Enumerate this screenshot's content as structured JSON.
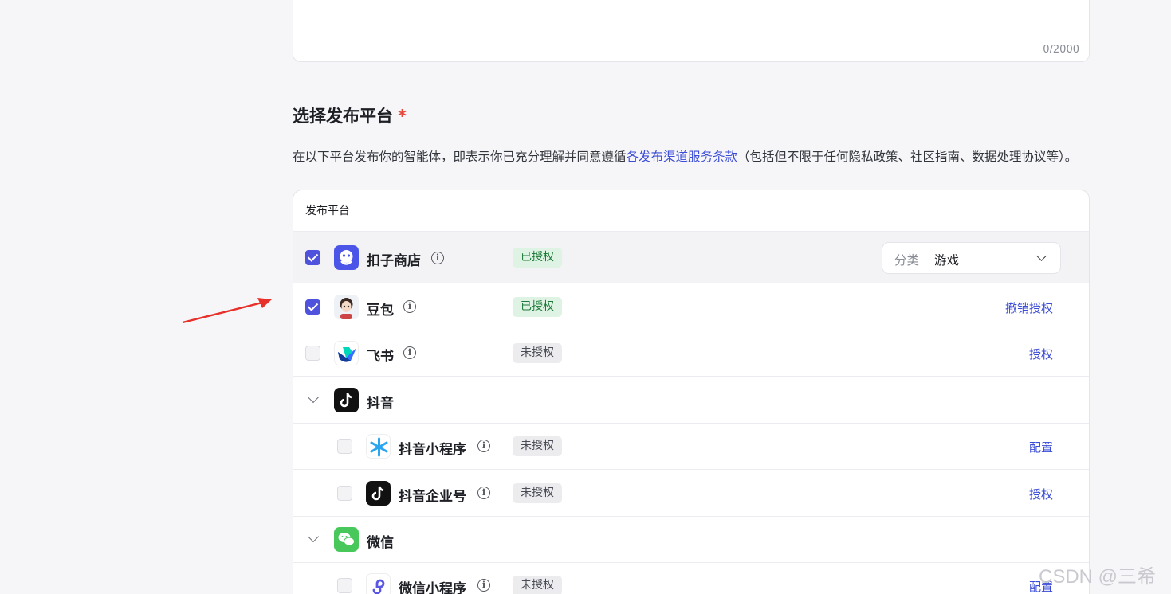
{
  "description_box": {
    "char_count": "0/2000"
  },
  "section": {
    "title": "选择发布平台",
    "required_mark": "*",
    "desc_before": "在以下平台发布你的智能体，即表示你已充分理解并同意遵循",
    "desc_link": "各发布渠道服务条款",
    "desc_after": "（包括但不限于任何隐私政策、社区指南、数据处理协议等）。"
  },
  "table": {
    "header": "发布平台",
    "rows": [
      {
        "name": "扣子商店",
        "checked": true,
        "badge": "已授权",
        "status": "authorized",
        "category_label": "分类",
        "category_value": "游戏",
        "icon": "coze-store-icon"
      },
      {
        "name": "豆包",
        "checked": true,
        "badge": "已授权",
        "status": "authorized",
        "action": "撤销授权",
        "icon": "doubao-icon"
      },
      {
        "name": "飞书",
        "checked": false,
        "badge": "未授权",
        "status": "unauthorized",
        "action": "授权",
        "icon": "feishu-icon"
      },
      {
        "name": "抖音",
        "group": true,
        "expanded": true,
        "icon": "douyin-icon"
      },
      {
        "name": "抖音小程序",
        "checked": false,
        "badge": "未授权",
        "status": "unauthorized",
        "action": "配置",
        "icon": "douyin-miniapp-icon"
      },
      {
        "name": "抖音企业号",
        "checked": false,
        "badge": "未授权",
        "status": "unauthorized",
        "action": "授权",
        "icon": "douyin-enterprise-icon"
      },
      {
        "name": "微信",
        "group": true,
        "expanded": true,
        "icon": "wechat-icon"
      },
      {
        "name": "微信小程序",
        "checked": false,
        "badge": "未授权",
        "status": "unauthorized",
        "action": "配置",
        "icon": "wechat-miniapp-icon"
      }
    ]
  },
  "watermark": "CSDN @三希",
  "colors": {
    "accent": "#4e52dc",
    "link": "#3b4cd6",
    "authorized_bg": "#dff3e4",
    "arrow": "#e8302a"
  }
}
